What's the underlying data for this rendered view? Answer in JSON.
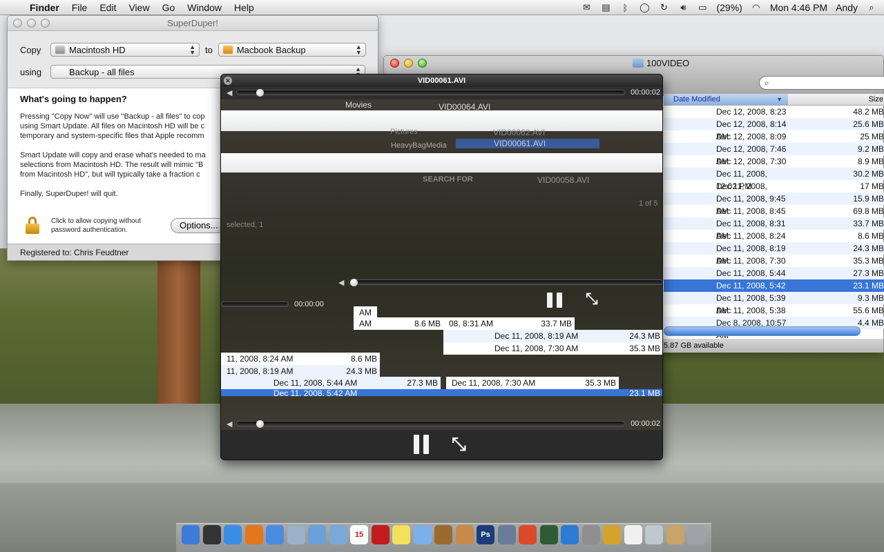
{
  "menubar": {
    "apple_icon": "apple-icon",
    "app_name": "Finder",
    "menus": [
      "File",
      "Edit",
      "View",
      "Go",
      "Window",
      "Help"
    ],
    "battery_percent": "(29%)",
    "clock": "Mon 4:46 PM",
    "user": "Andy",
    "status_icons": [
      "mail-icon",
      "screen-icon",
      "bluetooth-icon",
      "chat-icon",
      "sync-icon",
      "volume-icon",
      "battery-icon",
      "wifi-icon"
    ]
  },
  "superduper": {
    "title": "SuperDuper!",
    "copy_label": "Copy",
    "source": "Macintosh HD",
    "to_label": "to",
    "destination": "Macbook Backup",
    "using_label": "using",
    "script": "Backup - all files",
    "heading": "What's going to happen?",
    "para1_line1": "Pressing \"Copy Now\" will use \"Backup - all files\" to cop",
    "para1_line2": "using Smart Update. All files on Macintosh HD will be c",
    "para1_line3": "temporary and system-specific files that Apple recomm",
    "para2_line1": "Smart Update will copy and erase what's needed to ma",
    "para2_line2": "selections from Macintosh HD. The result will mimic \"B",
    "para2_line3": "from Macintosh HD\", but will typically take a fraction c",
    "para3": "Finally, SuperDuper! will quit.",
    "lock_text_line1": "Click to allow copying without",
    "lock_text_line2": "password authentication.",
    "options_button": "Options...",
    "registered": "Registered to: Chris Feudtner"
  },
  "finder": {
    "title": "100VIDEO",
    "col_date": "Date Modified",
    "col_size": "Size",
    "status": "5.87 GB available",
    "rows": [
      {
        "date": "Dec 12, 2008, 8:23 AM",
        "size": "48.2 MB"
      },
      {
        "date": "Dec 12, 2008, 8:14 AM",
        "size": "25.6 MB"
      },
      {
        "date": "Dec 12, 2008, 8:09 AM",
        "size": "25 MB"
      },
      {
        "date": "Dec 12, 2008, 7:46 AM",
        "size": "9.2 MB"
      },
      {
        "date": "Dec 12, 2008, 7:30 AM",
        "size": "8.9 MB"
      },
      {
        "date": "Dec 11, 2008, 12:02 PM",
        "size": "30.2 MB"
      },
      {
        "date": "Dec 11, 2008, 10:06 AM",
        "size": "17 MB"
      },
      {
        "date": "Dec 11, 2008, 9:45 AM",
        "size": "15.9 MB"
      },
      {
        "date": "Dec 11, 2008, 8:45 AM",
        "size": "69.8 MB"
      },
      {
        "date": "Dec 11, 2008, 8:31 AM",
        "size": "33.7 MB"
      },
      {
        "date": "Dec 11, 2008, 8:24 AM",
        "size": "8.6 MB"
      },
      {
        "date": "Dec 11, 2008, 8:19 AM",
        "size": "24.3 MB"
      },
      {
        "date": "Dec 11, 2008, 7:30 AM",
        "size": "35.3 MB"
      },
      {
        "date": "Dec 11, 2008, 5:44 AM",
        "size": "27.3 MB"
      },
      {
        "date": "Dec 11, 2008, 5:42 AM",
        "size": "23.1 MB"
      },
      {
        "date": "Dec 11, 2008, 5:39 AM",
        "size": "9.3 MB"
      },
      {
        "date": "Dec 11, 2008, 5:38 AM",
        "size": "55.6 MB"
      },
      {
        "date": "Dec 8, 2008, 10:57 AM",
        "size": "4.4 MB"
      }
    ]
  },
  "quicktime": {
    "title": "VID00061.AVI",
    "time_top": "00:00:02",
    "time_mid": "00:00:00",
    "time_bottom": "00:00:02",
    "ghost_items": [
      "Movies",
      "VID00064.AVI",
      "Pictures",
      "VID00062.AVI",
      "HeavyBagMedia",
      "VID00061.AVI",
      "SEARCH FOR",
      "VID00058.AVI",
      "1 of 5",
      "selected, 1"
    ],
    "ghost_rows": [
      {
        "date": "AM",
        "size": ""
      },
      {
        "date": "AM",
        "size": "8.6 MB"
      },
      {
        "date": "08, 8:31 AM",
        "size": "33.7 MB"
      },
      {
        "date": "Dec 11, 2008, 8:19 AM",
        "size": "24.3 MB"
      },
      {
        "date": "Dec 11, 2008, 7:30 AM",
        "size": "35.3 MB"
      },
      {
        "date": "11, 2008, 8:24 AM",
        "size": "8.6 MB"
      },
      {
        "date": "11, 2008, 8:19 AM",
        "size": "24.3 MB"
      },
      {
        "date": "Dec 11, 2008, 5:44 AM",
        "size": "27.3 MB"
      },
      {
        "date": "Dec 11, 2008, 7:30 AM",
        "size": "35.3 MB"
      },
      {
        "date": "Dec 11, 2008, 5:42 AM",
        "size": "23.1 MB"
      }
    ]
  },
  "dock": {
    "items": [
      "finder-icon",
      "dashboard-icon",
      "safari-icon",
      "firefox-icon",
      "ichat-icon",
      "mail-icon",
      "iphoto-icon",
      "preview-icon",
      "ical-icon",
      "flashcards-icon",
      "stickies-icon",
      "itunes-icon",
      "paw-icon",
      "address-icon",
      "photoshop-icon",
      "utility-icon",
      "colorsync-icon",
      "activity-icon",
      "quicktime-icon",
      "sysprefs-icon",
      "camino-icon",
      "textedit-icon",
      "preview2-icon",
      "docs-icon",
      "trash-icon"
    ],
    "photoshop_label": "Ps",
    "ical_label": "15"
  }
}
